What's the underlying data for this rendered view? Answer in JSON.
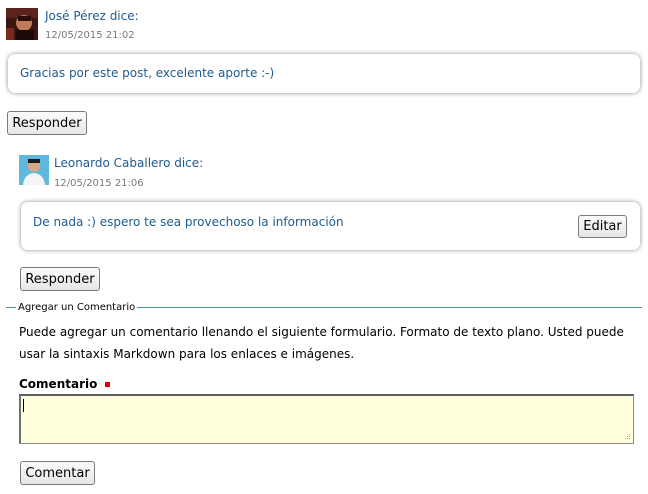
{
  "comments": [
    {
      "author": "José Pérez dice:",
      "date": "12/05/2015 21:02",
      "text": "Gracias por este post, excelente aporte :-)",
      "reply_label": "Responder"
    },
    {
      "author": "Leonardo Caballero dice:",
      "date": "12/05/2015 21:06",
      "text": "De nada :) espero te sea provechoso la información",
      "edit_label": "Editar",
      "reply_label": "Responder"
    }
  ],
  "form": {
    "legend": "Agregar un Comentario",
    "help": "Puede agregar un comentario llenando el siguiente formulario. Formato de texto plano. Usted puede usar la sintaxis Markdown para los enlaces e imágenes.",
    "field_label": "Comentario",
    "field_value": "",
    "submit_label": "Comentar"
  },
  "colors": {
    "link": "#205c90",
    "date": "#76797c",
    "required": "#e00000",
    "textarea_bg": "#ffffdd",
    "legend_line": "#4f90b6"
  }
}
